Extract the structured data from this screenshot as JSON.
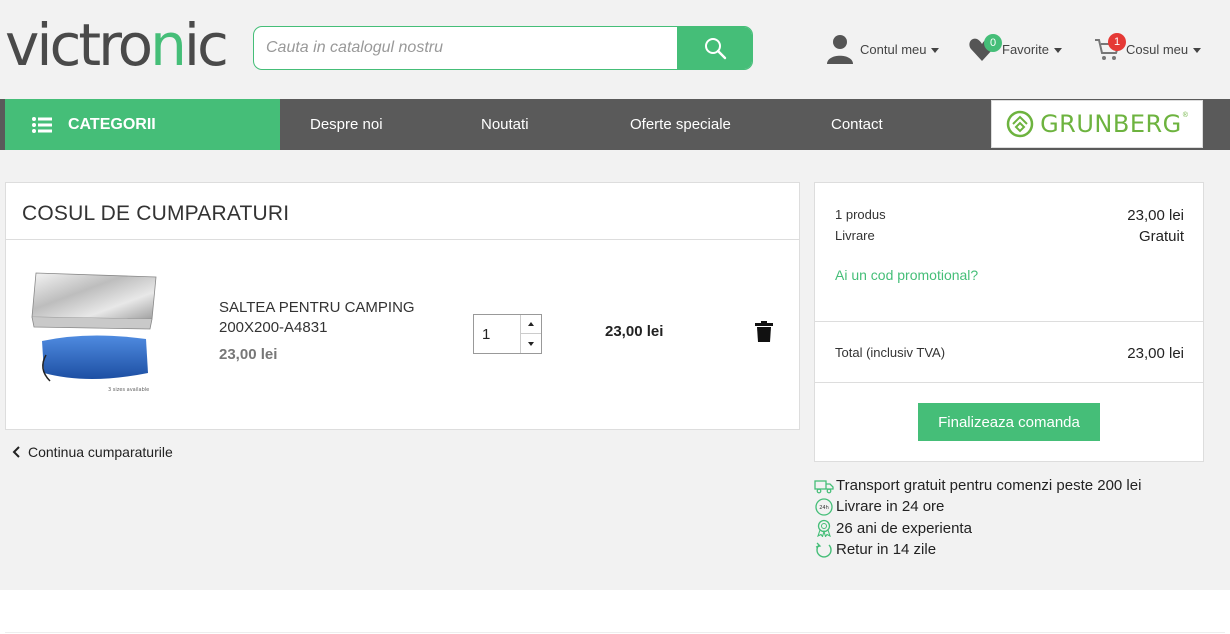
{
  "header": {
    "logo_main": "victro",
    "logo_accent": "n",
    "logo_end": "ic",
    "search": {
      "placeholder": "Cauta in catalogul nostru"
    },
    "account": {
      "label": "Contul meu"
    },
    "favorites": {
      "label": "Favorite",
      "count": "0"
    },
    "cart": {
      "label": "Cosul meu",
      "count": "1"
    }
  },
  "nav": {
    "categories_label": "CATEGORII",
    "links": [
      "Despre noi",
      "Noutati",
      "Oferte speciale",
      "Contact"
    ],
    "brand": "GRUNBERG",
    "brand_mark": "®"
  },
  "cart": {
    "title": "COSUL DE CUMPARATURI",
    "item": {
      "name": "SALTEA PENTRU CAMPING 200X200-A4831",
      "unit_price": "23,00 lei",
      "image_caption": "3 sizes available",
      "quantity": "1",
      "line_total": "23,00 lei"
    },
    "continue_label": "Continua cumparaturile"
  },
  "summary": {
    "products_label": "1 produs",
    "products_value": "23,00 lei",
    "shipping_label": "Livrare",
    "shipping_value": "Gratuit",
    "promo_label": "Ai un cod promotional?",
    "total_label": "Total (inclusiv TVA)",
    "total_value": "23,00 lei",
    "checkout_label": "Finalizeaza comanda"
  },
  "perks": [
    {
      "icon": "truck-icon",
      "text": "Transport gratuit pentru comenzi peste 200 lei"
    },
    {
      "icon": "24h-icon",
      "text": "Livrare in 24 ore"
    },
    {
      "icon": "award-icon",
      "text": "26 ani de experienta"
    },
    {
      "icon": "return-icon",
      "text": "Retur in 14 zile"
    }
  ],
  "colors": {
    "accent": "#45be78",
    "nav_bg": "#5a5a5a",
    "badge_fav": "#45be78",
    "badge_cart": "#e53935"
  }
}
